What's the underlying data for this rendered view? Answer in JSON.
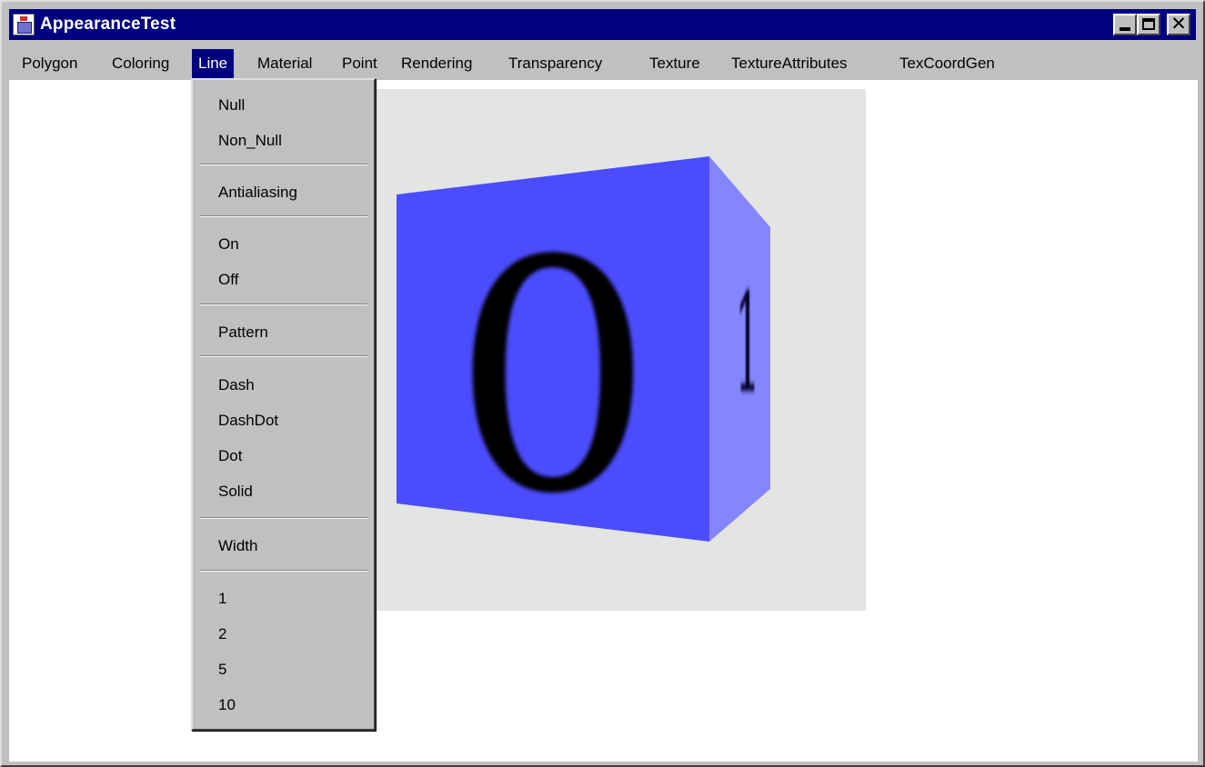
{
  "window": {
    "title": "AppearanceTest",
    "icon": "java-cup-icon",
    "controls": [
      "minimize-icon",
      "maximize-icon",
      "close-icon"
    ],
    "close_glyph": "✕"
  },
  "menubar": {
    "items": [
      {
        "label": "Polygon"
      },
      {
        "label": "Coloring"
      },
      {
        "label": "Line",
        "active": true
      },
      {
        "label": "Material"
      },
      {
        "label": "Point"
      },
      {
        "label": "Rendering"
      },
      {
        "label": "Transparency"
      },
      {
        "label": "Texture"
      },
      {
        "label": "TextureAttributes"
      },
      {
        "label": "TexCoordGen"
      }
    ]
  },
  "line_menu": {
    "items": [
      "Null",
      "Non_Null",
      "Antialiasing",
      "On",
      "Off",
      "Pattern",
      "Dash",
      "DashDot",
      "Dot",
      "Solid",
      "Width",
      "1",
      "2",
      "5",
      "10"
    ]
  },
  "scene": {
    "front_face_glyph": "0",
    "side_face_glyph": "1",
    "colors": {
      "background": "#e3e5e3",
      "front_face": "#4c4cff",
      "side_face": "#8585ff",
      "glyph": "#000000"
    }
  }
}
